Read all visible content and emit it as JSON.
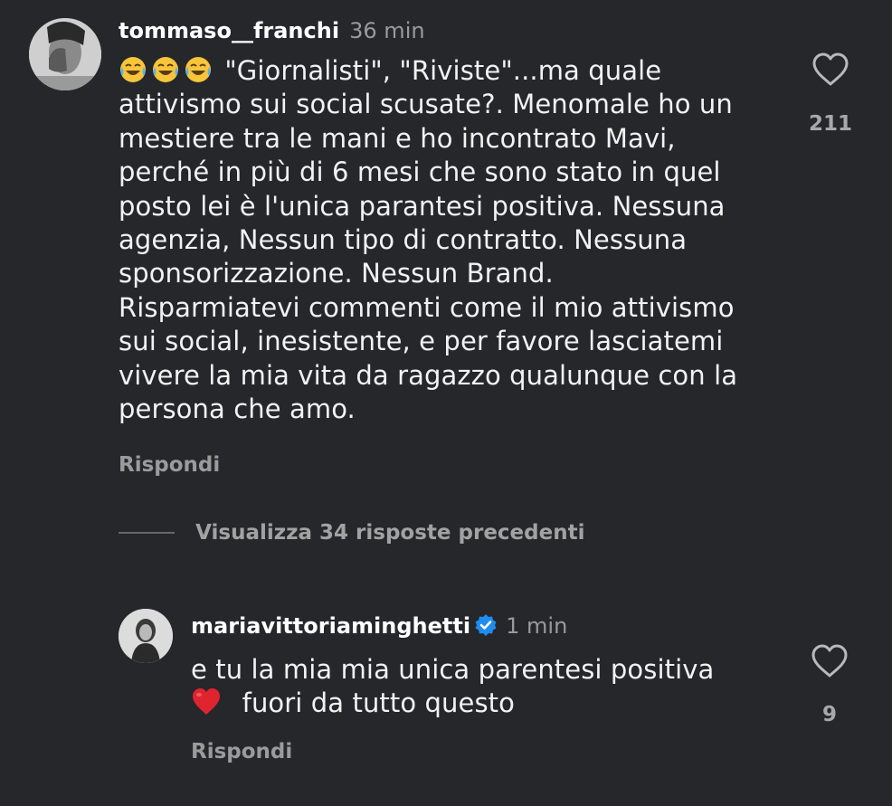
{
  "comments": [
    {
      "username": "tommaso__franchi",
      "time": "36 min",
      "lines": [
        "\"Giornalisti\", \"Riviste\"...ma quale",
        "attivismo sui social scusate?. Menomale ho un",
        "mestiere tra le mani e ho incontrato Mavi,",
        "perché in più di 6 mesi che sono stato in quel",
        "posto lei è l'unica parantesi positiva. Nessuna",
        "agenzia, Nessun tipo di contratto. Nessuna",
        "sponsorizzazione. Nessun Brand.",
        "Risparmiatevi commenti come il mio attivismo",
        "sui social, inesistente, e per favore lasciatemi",
        "vivere la mia vita da ragazzo qualunque con la",
        "persona che amo."
      ],
      "likes": "211",
      "reply_label": "Rispondi",
      "emoji_icon": "face-with-tears-of-joy-icon"
    },
    {
      "username": "mariavittoriaminghetti",
      "time": "1 min",
      "lines": [
        "e tu la mia mia unica parentesi positiva",
        "fuori da tutto questo"
      ],
      "likes": "9",
      "reply_label": "Rispondi",
      "emoji_icon": "red-heart-icon"
    }
  ],
  "view_previous_replies": "Visualizza 34 risposte precedenti",
  "colors": {
    "background": "#25272b",
    "verified": "#1f8cf0",
    "heart_emoji": "#e0242f"
  }
}
